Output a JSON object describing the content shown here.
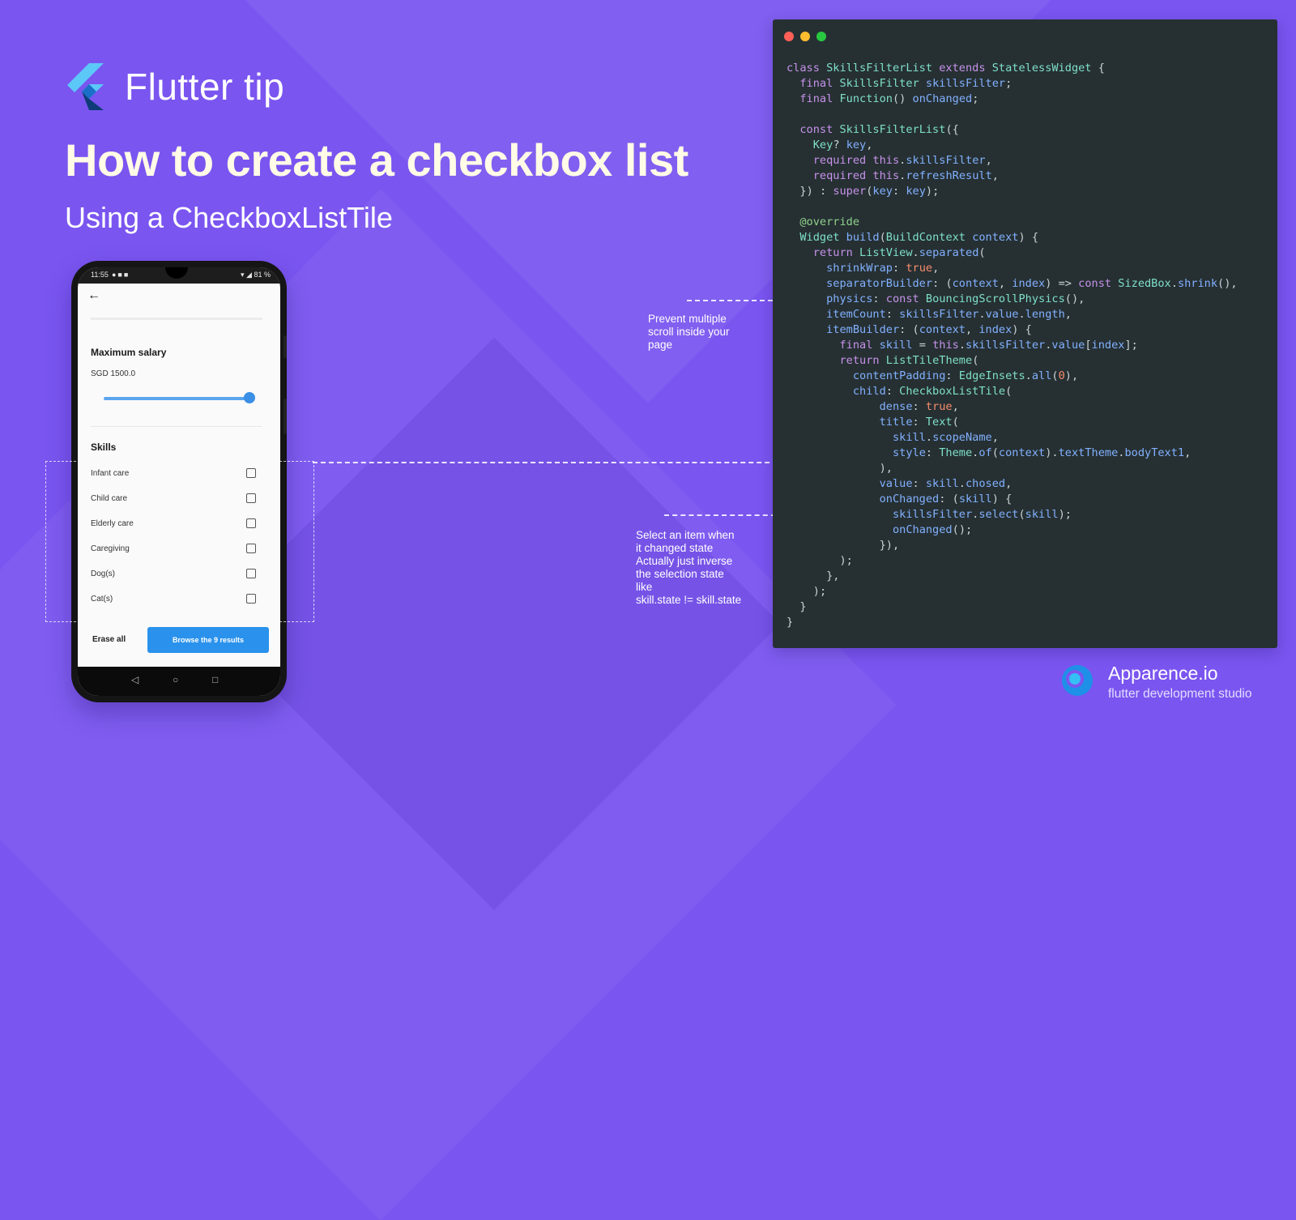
{
  "header": {
    "tip_title": "Flutter tip",
    "headline": "How to create a checkbox list",
    "subhead": "Using a CheckboxListTile"
  },
  "phone": {
    "status_time": "11:55",
    "status_right": "81 %",
    "salary_section": "Maximum salary",
    "salary_value": "SGD 1500.0",
    "salary_level": 1.0,
    "skills_section": "Skills",
    "skills": [
      {
        "label": "Infant care",
        "checked": false
      },
      {
        "label": "Child care",
        "checked": false
      },
      {
        "label": "Elderly care",
        "checked": false
      },
      {
        "label": "Caregiving",
        "checked": false
      },
      {
        "label": "Dog(s)",
        "checked": false
      },
      {
        "label": "Cat(s)",
        "checked": false
      }
    ],
    "erase_label": "Erase all",
    "browse_label": "Browse the 9 results"
  },
  "annotations": {
    "scroll_note": [
      "Prevent multiple",
      "scroll inside your",
      "page"
    ],
    "select_note": [
      "Select an item when",
      "it changed state",
      "Actually just inverse",
      "the selection state",
      "like",
      "skill.state != skill.state"
    ]
  },
  "code_lines": [
    "class SkillsFilterList extends StatelessWidget {",
    "  final SkillsFilter skillsFilter;",
    "  final Function() onChanged;",
    "",
    "  const SkillsFilterList({",
    "    Key? key,",
    "    required this.skillsFilter,",
    "    required this.refreshResult,",
    "  }) : super(key: key);",
    "",
    "  @override",
    "  Widget build(BuildContext context) {",
    "    return ListView.separated(",
    "      shrinkWrap: true,",
    "      separatorBuilder: (context, index) => const SizedBox.shrink(),",
    "      physics: const BouncingScrollPhysics(),",
    "      itemCount: skillsFilter.value.length,",
    "      itemBuilder: (context, index) {",
    "        final skill = this.skillsFilter.value[index];",
    "        return ListTileTheme(",
    "          contentPadding: EdgeInsets.all(0),",
    "          child: CheckboxListTile(",
    "              dense: true,",
    "              title: Text(",
    "                skill.scopeName,",
    "                style: Theme.of(context).textTheme.bodyText1,",
    "              ),",
    "              value: skill.chosed,",
    "              onChanged: (skill) {",
    "                skillsFilter.select(skill);",
    "                onChanged();",
    "              }),",
    "        );",
    "      },",
    "    );",
    "  }",
    "}"
  ],
  "brand": {
    "name": "Apparence.io",
    "tagline": "flutter development studio"
  },
  "colors": {
    "background": "#7a55f0",
    "headline": "#fffbe6",
    "code_bg": "#263033",
    "accent_blue": "#2a92ec"
  }
}
